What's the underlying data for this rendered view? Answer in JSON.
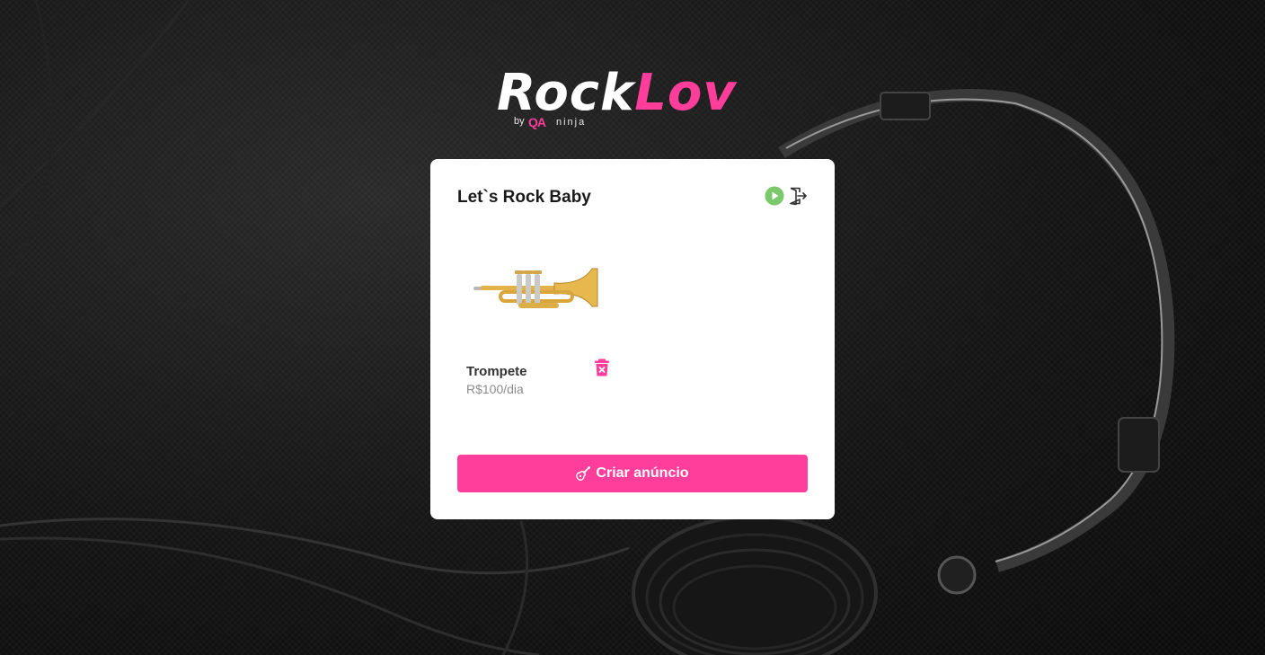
{
  "brand": {
    "name_part1": "Rock",
    "name_part2": "Lov",
    "by": "by",
    "qa_badge": "QA",
    "ninja": "ninja",
    "accent_color": "#ff3d9a"
  },
  "card": {
    "title": "Let`s Rock Baby",
    "header_icons": [
      "play-icon",
      "logout-icon"
    ]
  },
  "items": [
    {
      "name": "Trompete",
      "price": "R$100/dia",
      "image": "trumpet-image",
      "delete_icon": "trash-icon"
    }
  ],
  "create_button": {
    "label": "Criar anúncio",
    "icon": "guitar-icon"
  }
}
